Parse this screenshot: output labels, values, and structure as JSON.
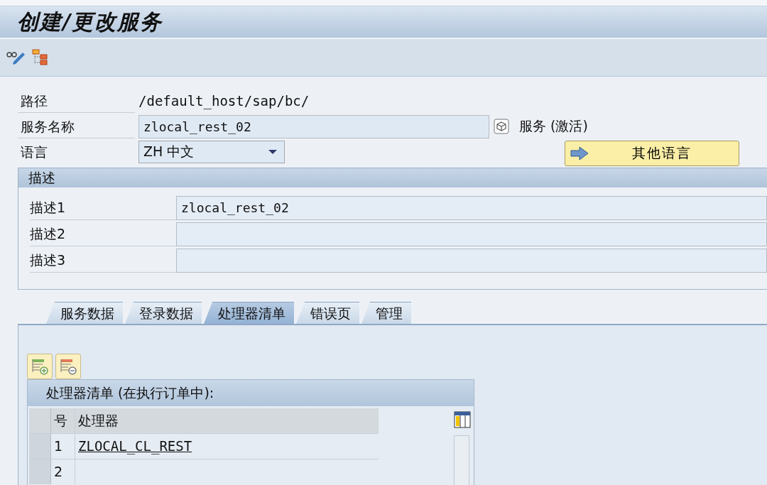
{
  "title": "创建/更改服务",
  "path": {
    "label": "路径",
    "value": "/default_host/sap/bc/"
  },
  "service_name": {
    "label": "服务名称",
    "value": "zlocal_rest_02",
    "status": "服务 (激活)"
  },
  "language": {
    "label": "语言",
    "value": "ZH 中文"
  },
  "other_languages_button": "其他语言",
  "description": {
    "title": "描述",
    "rows": [
      {
        "label": "描述1",
        "value": "zlocal_rest_02"
      },
      {
        "label": "描述2"
      },
      {
        "label": "描述3"
      }
    ]
  },
  "tabs": [
    {
      "label": "服务数据",
      "selected": false
    },
    {
      "label": "登录数据",
      "selected": false
    },
    {
      "label": "处理器清单",
      "selected": true
    },
    {
      "label": "错误页",
      "selected": false
    },
    {
      "label": "管理",
      "selected": false
    }
  ],
  "handler_table": {
    "title": "处理器清单 (在执行订单中):",
    "columns": [
      "号",
      "处理器"
    ],
    "rows": [
      {
        "no": "1",
        "handler": "ZLOCAL_CL_REST"
      },
      {
        "no": "2"
      }
    ]
  }
}
